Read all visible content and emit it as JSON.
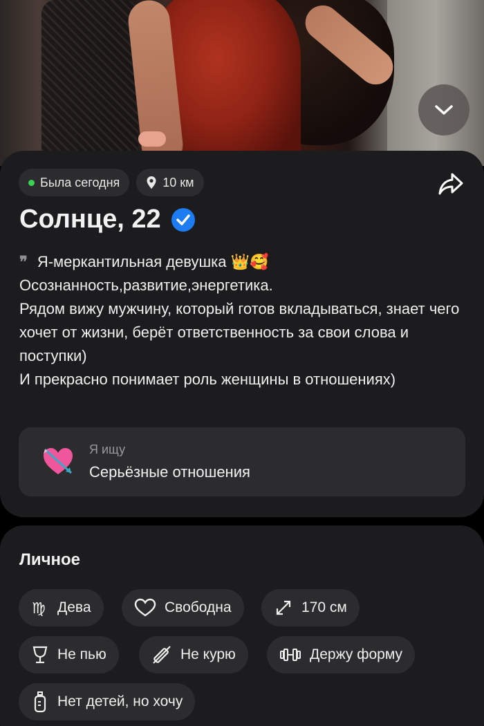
{
  "profile": {
    "status_label": "Была сегодня",
    "distance": "10 км",
    "name_age": "Солнце, 22",
    "bio_lines": [
      "Я-меркантильная девушка 👑🥰",
      "Осознанность,развитие,энергетика.",
      "Рядом вижу мужчину, который готов вкладываться, знает чего хочет от жизни, берёт ответственность за свои слова и поступки)",
      "И прекрасно понимает роль женщины в отношениях)"
    ],
    "looking_for_label": "Я ищу",
    "looking_for_value": "Серьёзные отношения"
  },
  "personal": {
    "title": "Личное",
    "tags": [
      {
        "label": "Дева",
        "icon": "virgo-icon"
      },
      {
        "label": "Свободна",
        "icon": "heart-outline-icon"
      },
      {
        "label": "170 см",
        "icon": "height-arrows-icon"
      },
      {
        "label": "Не пью",
        "icon": "wine-glass-icon"
      },
      {
        "label": "Не курю",
        "icon": "no-smoking-icon"
      },
      {
        "label": "Держу форму",
        "icon": "dumbbell-icon"
      },
      {
        "label": "Нет детей, но хочу",
        "icon": "baby-bottle-icon"
      }
    ]
  },
  "colors": {
    "background": "#000000",
    "card": "#1c1c1e",
    "chip": "#2c2c2e",
    "online_dot": "#39d353",
    "verified": "#1e7cf2"
  }
}
